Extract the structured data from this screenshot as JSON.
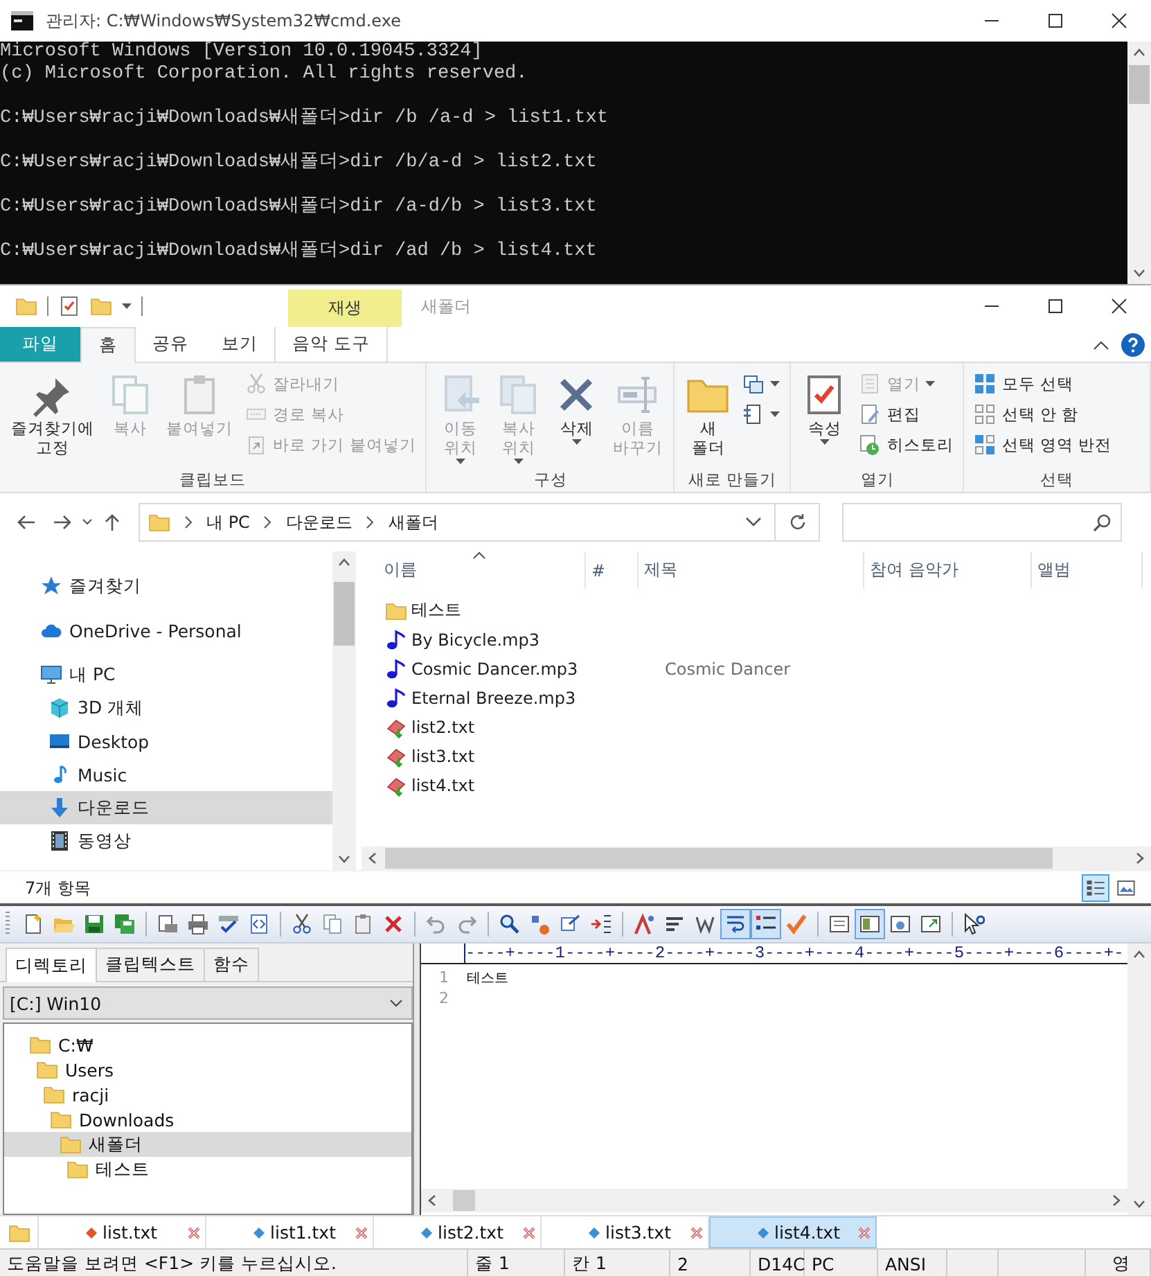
{
  "cmd": {
    "title": "관리자: C:₩Windows₩System32₩cmd.exe",
    "blocks": [
      [
        "Microsoft Windows [Version 10.0.19045.3324]",
        "(c) Microsoft Corporation. All rights reserved."
      ],
      [
        "C:₩Users₩racji₩Downloads₩새폴더>dir /b /a-d > list1.txt"
      ],
      [
        "C:₩Users₩racji₩Downloads₩새폴더>dir /b/a-d > list2.txt"
      ],
      [
        "C:₩Users₩racji₩Downloads₩새폴더>dir /a-d/b > list3.txt"
      ],
      [
        "C:₩Users₩racji₩Downloads₩새폴더>dir /ad /b > list4.txt"
      ]
    ]
  },
  "explorer": {
    "context_group": "재생",
    "title": "새폴더",
    "tabs": [
      {
        "label": "파일",
        "kind": "file",
        "selected": false
      },
      {
        "label": "홈",
        "kind": "tab",
        "selected": true
      },
      {
        "label": "공유",
        "kind": "tab",
        "selected": false
      },
      {
        "label": "보기",
        "kind": "tab",
        "selected": false
      },
      {
        "label": "음악 도구",
        "kind": "contextual",
        "selected": false
      }
    ],
    "ribbon": [
      {
        "label": "클립보드",
        "items": [
          {
            "label": "즐겨찾기에 고정",
            "kind": "large",
            "disabled": false,
            "menu": false
          },
          {
            "label": "복사",
            "kind": "large",
            "disabled": true,
            "menu": false
          },
          {
            "label": "붙여넣기",
            "kind": "large",
            "disabled": true,
            "menu": false
          },
          {
            "label": "잘라내기",
            "kind": "small",
            "disabled": true,
            "menu": false
          },
          {
            "label": "경로 복사",
            "kind": "small",
            "disabled": true,
            "menu": false
          },
          {
            "label": "바로 가기 붙여넣기",
            "kind": "small",
            "disabled": true,
            "menu": false
          }
        ]
      },
      {
        "label": "구성",
        "items": [
          {
            "label": "이동 위치",
            "kind": "large",
            "disabled": true,
            "menu": true
          },
          {
            "label": "복사 위치",
            "kind": "large",
            "disabled": true,
            "menu": true
          },
          {
            "label": "삭제",
            "kind": "large",
            "disabled": false,
            "menu": true
          },
          {
            "label": "이름 바꾸기",
            "kind": "large",
            "disabled": true,
            "menu": false
          }
        ]
      },
      {
        "label": "새로 만들기",
        "items": [
          {
            "label": "새 폴더",
            "kind": "large",
            "disabled": false,
            "menu": false
          },
          {
            "kind": "icon",
            "disabled": false,
            "menu": true
          },
          {
            "kind": "icon",
            "disabled": false,
            "menu": true
          }
        ]
      },
      {
        "label": "열기",
        "items": [
          {
            "label": "속성",
            "kind": "large",
            "disabled": false,
            "menu": true
          },
          {
            "label": "열기",
            "kind": "small",
            "disabled": true,
            "menu": true
          },
          {
            "label": "편집",
            "kind": "small",
            "disabled": false,
            "menu": false
          },
          {
            "label": "히스토리",
            "kind": "small",
            "disabled": false,
            "menu": false
          }
        ]
      },
      {
        "label": "선택",
        "items": [
          {
            "label": "모두 선택",
            "kind": "small",
            "disabled": false,
            "menu": false
          },
          {
            "label": "선택 안 함",
            "kind": "small",
            "disabled": false,
            "menu": false
          },
          {
            "label": "선택 영역 반전",
            "kind": "small",
            "disabled": false,
            "menu": false
          }
        ]
      }
    ],
    "address": [
      "내 PC",
      "다운로드",
      "새폴더"
    ],
    "nav": [
      {
        "label": "즐겨찾기",
        "selected": false
      },
      {
        "label": "OneDrive - Personal",
        "selected": false
      },
      {
        "label": "내 PC",
        "selected": false,
        "children": [
          {
            "label": "3D 개체",
            "selected": false
          },
          {
            "label": "Desktop",
            "selected": false
          },
          {
            "label": "Music",
            "selected": false
          },
          {
            "label": "다운로드",
            "selected": true
          },
          {
            "label": "동영상",
            "selected": false
          }
        ]
      }
    ],
    "columns": [
      "이름",
      "#",
      "제목",
      "참여 음악가",
      "앨범"
    ],
    "files": [
      {
        "name": "테스트",
        "kind": "folder"
      },
      {
        "name": "By Bicycle.mp3",
        "kind": "audio"
      },
      {
        "name": "Cosmic Dancer.mp3",
        "kind": "audio",
        "title": "Cosmic Dancer"
      },
      {
        "name": "Eternal Breeze.mp3",
        "kind": "audio"
      },
      {
        "name": "list2.txt",
        "kind": "text"
      },
      {
        "name": "list3.txt",
        "kind": "text"
      },
      {
        "name": "list4.txt",
        "kind": "text"
      }
    ],
    "status": "7개 항목",
    "views": [
      {
        "kind": "details",
        "selected": true
      },
      {
        "kind": "tiles",
        "selected": false
      }
    ]
  },
  "editor": {
    "toolbar": [
      {
        "kind": "button",
        "on": false
      },
      {
        "kind": "button",
        "on": false
      },
      {
        "kind": "button",
        "on": false
      },
      {
        "kind": "button",
        "on": false
      },
      {
        "kind": "separator"
      },
      {
        "kind": "button",
        "on": false
      },
      {
        "kind": "button",
        "on": false
      },
      {
        "kind": "button",
        "on": false
      },
      {
        "kind": "button",
        "on": false
      },
      {
        "kind": "separator"
      },
      {
        "kind": "button",
        "on": false
      },
      {
        "kind": "button",
        "on": false
      },
      {
        "kind": "button",
        "on": false
      },
      {
        "kind": "button",
        "on": false
      },
      {
        "kind": "separator"
      },
      {
        "kind": "button",
        "on": false
      },
      {
        "kind": "button",
        "on": false
      },
      {
        "kind": "separator"
      },
      {
        "kind": "button",
        "on": false
      },
      {
        "kind": "button",
        "on": false
      },
      {
        "kind": "button",
        "on": false
      },
      {
        "kind": "button",
        "on": false
      },
      {
        "kind": "separator"
      },
      {
        "kind": "button",
        "on": false
      },
      {
        "kind": "button",
        "on": false
      },
      {
        "kind": "button",
        "on": false
      },
      {
        "kind": "button",
        "on": true
      },
      {
        "kind": "button",
        "on": true
      },
      {
        "kind": "button",
        "on": false
      },
      {
        "kind": "separator"
      },
      {
        "kind": "button",
        "on": false
      },
      {
        "kind": "button",
        "on": true
      },
      {
        "kind": "button",
        "on": false
      },
      {
        "kind": "button",
        "on": false
      },
      {
        "kind": "separator"
      },
      {
        "kind": "button",
        "on": false
      }
    ],
    "panel_tabs": [
      {
        "label": "디렉토리",
        "selected": true
      },
      {
        "label": "클립텍스트",
        "selected": false
      },
      {
        "label": "함수",
        "selected": false
      }
    ],
    "drive": "[C:] Win10",
    "tree": [
      {
        "label": "C:₩",
        "selected": false,
        "children": [
          {
            "label": "Users",
            "selected": false,
            "children": [
              {
                "label": "racji",
                "selected": false,
                "children": [
                  {
                    "label": "Downloads",
                    "selected": false,
                    "children": [
                      {
                        "label": "새폴더",
                        "selected": true,
                        "children": [
                          {
                            "label": "테스트",
                            "selected": false
                          }
                        ]
                      }
                    ]
                  }
                ]
              }
            ]
          }
        ]
      }
    ],
    "ruler": "----+----1----+----2----+----3----+----4----+----5----+----6----+-",
    "lines": [
      {
        "number": "1",
        "text": "테스트"
      },
      {
        "number": "2"
      }
    ],
    "doc_tabs": [
      {
        "label": "list.txt",
        "color": "#e0552a",
        "selected": false
      },
      {
        "label": "list1.txt",
        "color": "#3a8fd6",
        "selected": false
      },
      {
        "label": "list2.txt",
        "color": "#3a8fd6",
        "selected": false
      },
      {
        "label": "list3.txt",
        "color": "#3a8fd6",
        "selected": false
      },
      {
        "label": "list4.txt",
        "color": "#3a8fd6",
        "selected": true
      }
    ],
    "status": [
      "도움말을 보려면 <F1> 키를 누르십시오.",
      "줄 1",
      "칸 1",
      "2",
      "D14C",
      "PC",
      "ANSI",
      "영"
    ]
  }
}
